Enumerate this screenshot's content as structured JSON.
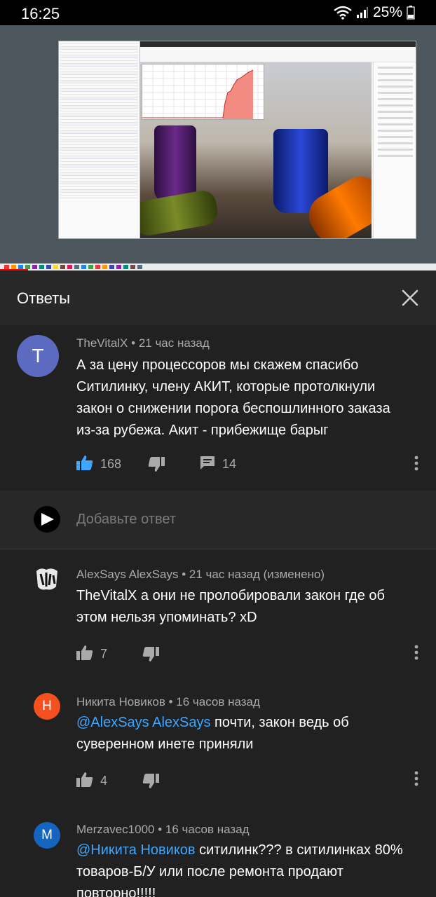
{
  "status_bar": {
    "time": "16:25",
    "battery": "25%",
    "icons": [
      "wifi-icon",
      "signal-icon",
      "battery-icon"
    ]
  },
  "video": {
    "description_icons": [
      "desktop-screenshot"
    ],
    "progress_color": "#ff0000"
  },
  "panel": {
    "title": "Ответы",
    "close_icon": "close-icon"
  },
  "parent_comment": {
    "avatar_letter": "T",
    "avatar_color": "#5c6bc0",
    "author": "TheVitalX",
    "time": "• 21 час назад",
    "text": "А за цену процессоров мы скажем спасибо Ситилинку, члену АКИТ, которые протолкнули закон о снижении порога беспошлинного заказа из-за рубежа. Акит - прибежище барыг",
    "likes": "168",
    "replies": "14"
  },
  "add_reply": {
    "placeholder": "Добавьте ответ"
  },
  "replies": [
    {
      "author": "AlexSays AlexSays",
      "time": "• 21 час назад (изменено)",
      "text": "TheVitalX а они не пролобировали закон где об этом нельзя упоминать? xD",
      "likes": "7",
      "avatar_color": "#212121"
    },
    {
      "author": "Никита Новиков",
      "time": "• 16 часов назад",
      "mention": "@AlexSays AlexSays",
      "text": " почти, закон ведь об суверенном инете приняли",
      "likes": "4",
      "avatar_letter": "Н",
      "avatar_color": "#f4511e"
    },
    {
      "author": "Merzavec1000",
      "time": "• 16 часов назад",
      "mention": "@Никита Новиков",
      "text": " ситилинк??? в ситилинках 80% товаров-Б/У или после ремонта продают повторно!!!!!",
      "avatar_letter": "M",
      "avatar_color": "#1565c0"
    }
  ]
}
